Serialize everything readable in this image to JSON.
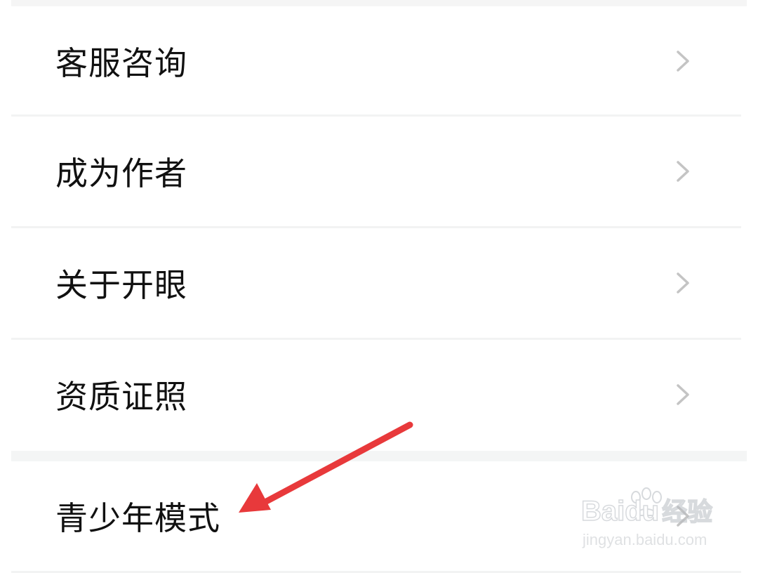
{
  "menu": {
    "items": [
      {
        "label": "客服咨询",
        "chevron_icon": "chevron-right-icon"
      },
      {
        "label": "成为作者",
        "chevron_icon": "chevron-right-icon"
      },
      {
        "label": "关于开眼",
        "chevron_icon": "chevron-right-icon"
      },
      {
        "label": "资质证照",
        "chevron_icon": "chevron-right-icon"
      },
      {
        "label": "青少年模式",
        "chevron_icon": "chevron-right-icon"
      }
    ]
  },
  "annotation": {
    "arrow_icon": "red-arrow-icon",
    "color": "#e8393b"
  },
  "watermark": {
    "brand": "Bai",
    "brand_suffix": "du",
    "brand_cn": "经验",
    "url": "jingyan.baidu.com",
    "icon": "paw-icon"
  },
  "colors": {
    "background": "#ffffff",
    "text": "#111111",
    "chevron": "#c4c4c4",
    "divider": "#f2f3f3"
  }
}
